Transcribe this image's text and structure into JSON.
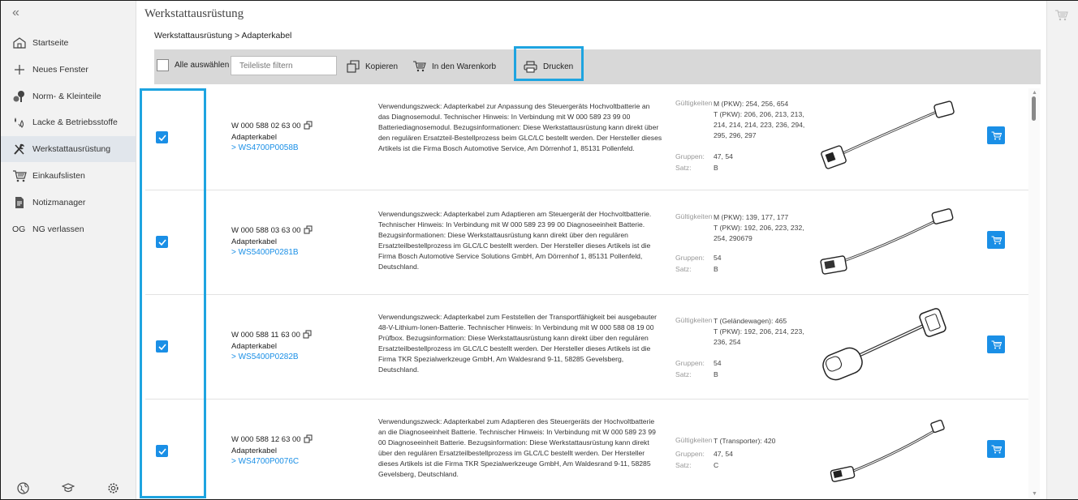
{
  "sidebar": {
    "collapse_glyph": "«",
    "items": [
      {
        "label": "Startseite",
        "icon": "home-icon"
      },
      {
        "label": "Neues Fenster",
        "icon": "plus-icon"
      },
      {
        "label": "Norm- & Kleinteile",
        "icon": "bolts-icon"
      },
      {
        "label": "Lacke & Betriebsstoffe",
        "icon": "fluids-icon"
      },
      {
        "label": "Werkstattausrüstung",
        "icon": "tools-icon",
        "active": true
      },
      {
        "label": "Einkaufslisten",
        "icon": "cart-list-icon"
      },
      {
        "label": "Notizmanager",
        "icon": "notes-icon"
      },
      {
        "label": "NG verlassen",
        "prefix": "OG"
      }
    ],
    "footer": [
      "globe-icon",
      "graduation-cap-icon",
      "settings-icon"
    ]
  },
  "main": {
    "title": "Werkstattausrüstung",
    "breadcrumb": "Werkstattausrüstung > Adapterkabel"
  },
  "toolbar": {
    "select_all": "Alle auswählen",
    "filter_placeholder": "Teileliste filtern",
    "copy": "Kopieren",
    "cart": "In den Warenkorb",
    "print": "Drucken"
  },
  "labels": {
    "validity": "Gültigkeiten",
    "groups": "Gruppen:",
    "set": "Satz:"
  },
  "items": [
    {
      "checked": true,
      "part_number": "W 000 588 02 63 00",
      "name": "Adapterkabel",
      "link": "> WS4700P0058B",
      "description": "Verwendungszweck: Adapterkabel zur Anpassung des Steuergeräts Hochvoltbatterie an das Diagnosemodul. Technischer Hinweis: In Verbindung mit W  000  589  23  99  00 Batteriediagnosemodul. Bezugsinformationen: Diese Werkstattausrüstung kann direkt über den regulären Ersatzteil-Bestellprozess beim GLC/LC bestellt werden. Der Hersteller dieses Artikels ist die Firma Bosch Automotive Service, Am Dörrenhof 1, 85131 Pollenfeld.",
      "validity": "M (PKW): 254, 256, 654\nT (PKW): 206, 206, 213, 213, 214, 214, 214, 223, 236, 294, 295, 296, 297",
      "groups": "47, 54",
      "set": "B"
    },
    {
      "checked": true,
      "part_number": "W 000 588 03 63 00",
      "name": "Adapterkabel",
      "link": "> WS5400P0281B",
      "description": "Verwendungszweck: Adapterkabel zum Adaptieren am Steuergerät der Hochvoltbatterie. Technischer Hinweis: In Verbindung mit W  000  589  23  99  00 Diagnoseeinheit Batterie. Bezugsinformationen: Diese Werkstattausrüstung kann direkt über den regulären Ersatzteilbestellprozess im GLC/LC bestellt werden. Der Hersteller dieses Artikels ist die Firma Bosch Automotive Service Solutions GmbH, Am Dörrenhof 1, 85131 Pollenfeld, Deutschland.",
      "validity": "M (PKW): 139, 177, 177\nT (PKW): 192, 206, 223, 232, 254, 290679",
      "groups": "54",
      "set": "B"
    },
    {
      "checked": true,
      "part_number": "W 000 588 11 63 00",
      "name": "Adapterkabel",
      "link": "> WS5400P0282B",
      "description": "Verwendungszweck: Adapterkabel zum Feststellen der Transportfähigkeit bei ausgebauter 48-V-Lithium-Ionen-Batterie. Technischer Hinweis: In Verbindung mit W  000  588  08  19  00 Prüfbox. Bezugsinformation: Diese Werkstattausrüstung kann direkt über den regulären Ersatzteilbestellprozess im GLC/LC bestellt werden. Der Hersteller dieses Artikels ist die Firma TKR Spezialwerkzeuge GmbH, Am Waldesrand 9-11, 58285 Gevelsberg, Deutschland.",
      "validity": "T (Geländewagen): 465\nT (PKW): 192, 206, 214, 223, 236, 254",
      "groups": "54",
      "set": "B"
    },
    {
      "checked": true,
      "part_number": "W 000 588 12 63 00",
      "name": "Adapterkabel",
      "link": "> WS4700P0076C",
      "description": "Verwendungszweck: Adapterkabel zum Adaptieren des Steuergeräts der Hochvoltbatterie an die Diagnoseeinheit Batterie. Technischer Hinweis: In Verbindung mit W  000  589  23  99  00 Diagnoseeinheit Batterie. Bezugsinformation: Diese Werkstattausrüstung kann direkt über den regulären Ersatzteilbestellprozess im GLC/LC bestellt werden. Der Hersteller dieses Artikels ist die Firma TKR Spezialwerkzeuge GmbH, Am Waldesrand 9-11, 58285 Gevelsberg, Deutschland.",
      "validity": "T (Transporter): 420",
      "groups": "47, 54",
      "set": "C"
    }
  ],
  "colors": {
    "accent": "#1a8fe6",
    "highlight": "#1ea4e0",
    "toolbar": "#d8d8d8",
    "sidebar": "#f2f2f2"
  }
}
